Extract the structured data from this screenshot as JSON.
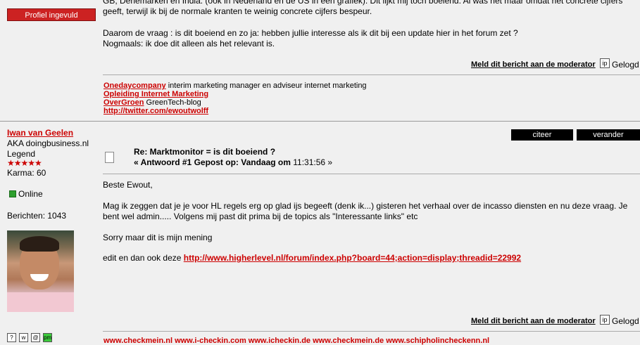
{
  "prev_post": {
    "profile_button": "Profiel ingevuld",
    "lines": [
      "GB, Denemarken en India. (ook in Nederland en de US in een grafiek). Dit lijkt mij toch boeiend. Al was het maar omdat het concrete cijfers",
      "geeft, terwijl ik bij de normale kranten te weinig concrete cijfers bespeur.",
      "Daarom de vraag : is dit boeiend en zo ja: hebben jullie interesse als ik dit bij een update hier in het forum zet ?",
      "Nogmaals: ik doe dit alleen als het relevant is."
    ],
    "report_link": "Meld dit bericht aan de moderator",
    "ip_icon": "ip-icon",
    "logged": "Gelogd",
    "signature": {
      "line1_link": "Onedaycompany",
      "line1_text": " interim marketing manager en adviseur internet marketing",
      "line2_link": "Opleiding Internet Marketing",
      "line3_link": "OverGroen",
      "line3_text": "  GreenTech-blog",
      "line4_link": "http://twitter.com/ewoutwolff"
    }
  },
  "post": {
    "author": {
      "name": "Iwan van Geelen",
      "aka": "AKA doingbusiness.nl",
      "rank": "Legend",
      "stars": "★★★★★",
      "karma": "Karma: 60",
      "status": "Online",
      "posts": "Berichten: 1043"
    },
    "quote_button": "citeer",
    "edit_button": "verander",
    "subject": "Re: Marktmonitor = is dit boeiend ?",
    "meta_prefix": "« Antwoord #1 Gepost op: Vandaag om",
    "meta_time": " 11:31:56 »",
    "body": {
      "greeting": "Beste Ewout,",
      "para1_line1": "Mag ik zeggen dat je je voor HL regels erg op glad ijs begeeft (denk ik...) gisteren het verhaal over de incasso diensten en nu deze vraag. Je",
      "para1_line2": "bent wel admin..... Volgens mij past dit prima bij de topics als \"Interessante links\" etc",
      "para2": "Sorry maar dit is mijn mening",
      "para3_text": "edit en dan ook deze ",
      "para3_link": "http://www.higherlevel.nl/forum/index.php?board=44;action=display;threadid=22992"
    },
    "report_link": "Meld dit bericht aan de moderator",
    "logged": "Gelogd",
    "footer_icons": [
      "?",
      "w",
      "@",
      "pm"
    ],
    "signature_partial": "www.checkmein.nl www.i-checkin.com  www.icheckin.de www.checkmein.de www.schipholincheckenn.nl"
  }
}
